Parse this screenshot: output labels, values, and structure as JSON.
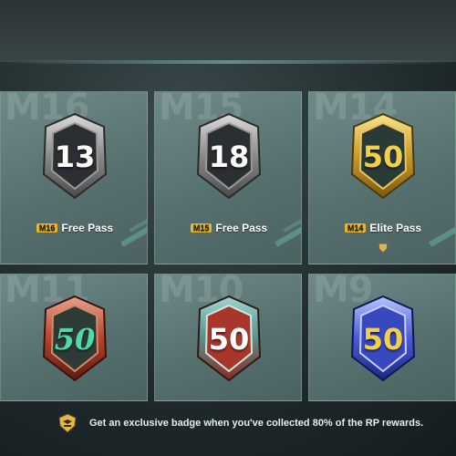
{
  "header": {
    "title": ""
  },
  "cards": [
    {
      "season": "M16",
      "badge_value": "13",
      "pass_tag": "M16",
      "pass_label": "Free Pass",
      "style": "silver"
    },
    {
      "season": "M15",
      "badge_value": "18",
      "pass_tag": "M15",
      "pass_label": "Free Pass",
      "style": "silver"
    },
    {
      "season": "M14",
      "badge_value": "50",
      "pass_tag": "M14",
      "pass_label": "Elite Pass",
      "style": "gold",
      "has_icon": true
    },
    {
      "season": "M11",
      "badge_value": "50",
      "pass_tag": "",
      "pass_label": "",
      "style": "red-script"
    },
    {
      "season": "M10",
      "badge_value": "50",
      "pass_tag": "",
      "pass_label": "",
      "style": "teal-red"
    },
    {
      "season": "M9",
      "badge_value": "50",
      "pass_tag": "",
      "pass_label": "",
      "style": "blue"
    }
  ],
  "footer": {
    "message": "Get an exclusive badge when you've collected 80% of the RP rewards.",
    "icon": "rp-emblem-icon"
  },
  "colors": {
    "gold": "#f3d04a",
    "tag_gold": "#e9b52a",
    "card_bg": "#5e7a78"
  }
}
